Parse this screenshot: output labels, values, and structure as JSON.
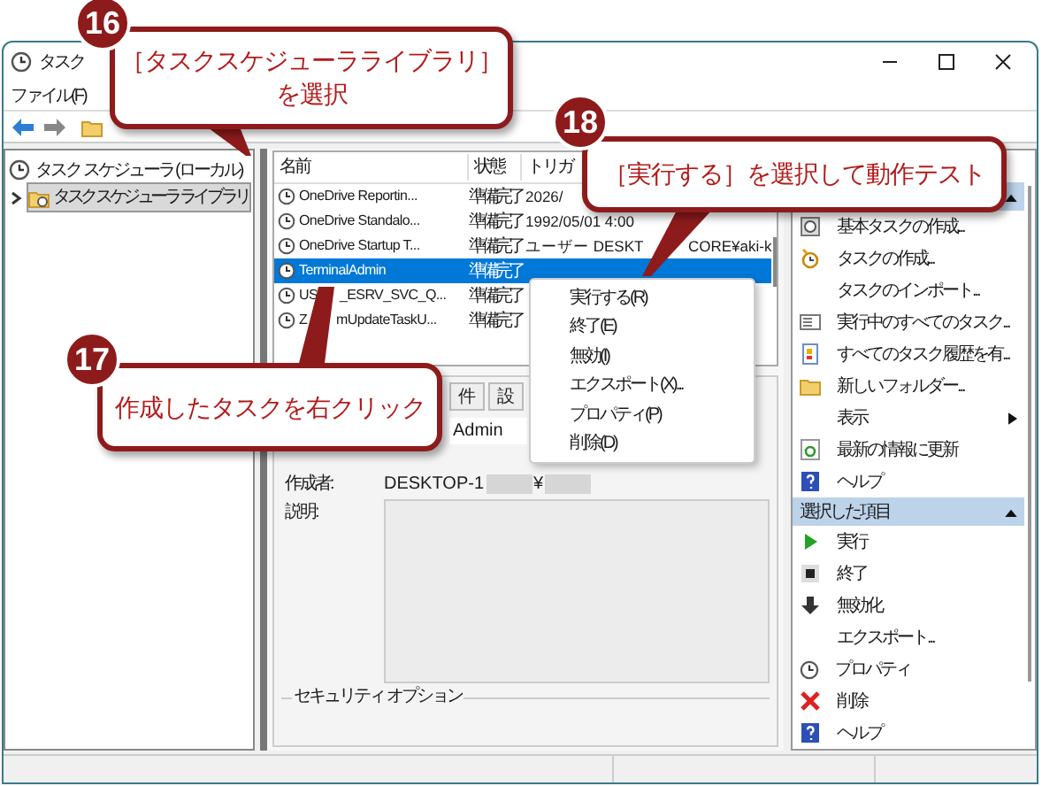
{
  "window": {
    "title": "タスク"
  },
  "menu": [
    "ファイル(F)"
  ],
  "tree": [
    {
      "label": "タスク スケジューラ (ローカル)",
      "selected": false,
      "children": [
        {
          "label": "タスク スケジューラ ライブラリ",
          "selected": true,
          "expanded": false
        }
      ]
    }
  ],
  "table": {
    "columns": [
      "名前",
      "状態",
      "トリガ"
    ],
    "rows": [
      {
        "name": [
          "OneDrive Reportin..."
        ],
        "status": "準備完了",
        "trigger": [
          "2026/"
        ],
        "selected": false
      },
      {
        "name": [
          "OneDrive Standalo..."
        ],
        "status": "準備完了",
        "trigger": [
          "1992/05/01 4:00"
        ],
        "selected": false
      },
      {
        "name": [
          "OneDrive Startup T..."
        ],
        "status": "準備完了",
        "trigger": [
          "ユーザー DESKT",
          "CORE¥aki-k"
        ],
        "selected": false
      },
      {
        "name": [
          "TerminalAdmin"
        ],
        "status": "準備完了",
        "selected": true
      },
      {
        "name": [
          "US",
          "_ESRV_SVC_Q..."
        ],
        "status": "準備完了",
        "selected": false
      },
      {
        "name": [
          "Z",
          "mUpdateTaskU..."
        ],
        "status": "準備完了",
        "selected": false
      }
    ]
  },
  "details": {
    "tabs": [
      {
        "label": "件",
        "selected": false
      },
      {
        "label": "設",
        "selected": false
      }
    ],
    "fields": [
      {
        "kind": "value",
        "value": "Admin"
      },
      {
        "kind": "redacted",
        "label": "作成者:",
        "parts": [
          "DESKTOP-1",
          "¥"
        ]
      },
      {
        "kind": "textarea",
        "label": "説明:"
      }
    ],
    "group": "セキュリティ オプション"
  },
  "context_menu": [
    "実行する(R)",
    "終了(E)",
    "無効(I)",
    "エクスポート(X)...",
    "プロパティ(P)",
    "削除(D)"
  ],
  "actions": {
    "sections": [
      {
        "items": [
          {
            "label": "基本タスクの作成..."
          },
          {
            "label": "タスクの作成..."
          },
          {
            "label": "タスクのインポート..."
          },
          {
            "label": "実行中のすべてのタスク..."
          },
          {
            "label": "すべてのタスク履歴を有..."
          },
          {
            "label": "新しいフォルダー..."
          },
          {
            "label": "表示",
            "kind": "submenu"
          },
          {
            "label": "最新の情報に更新"
          },
          {
            "label": "ヘルプ"
          }
        ]
      },
      {
        "title": "選択した項目",
        "items": [
          {
            "label": "実行"
          },
          {
            "label": "終了"
          },
          {
            "label": "無効化"
          },
          {
            "label": "エクスポート..."
          },
          {
            "label": "プロパティ"
          },
          {
            "label": "削除"
          },
          {
            "label": "ヘルプ"
          }
        ]
      }
    ]
  },
  "callouts": [
    {
      "number": "16",
      "lines": [
        "［タスクスケジューラライブラリ］",
        "を選択"
      ]
    },
    {
      "number": "18",
      "lines": [
        "［実行する］を選択して動作テスト"
      ]
    },
    {
      "number": "17",
      "lines": [
        "作成したタスクを右クリック"
      ]
    }
  ]
}
